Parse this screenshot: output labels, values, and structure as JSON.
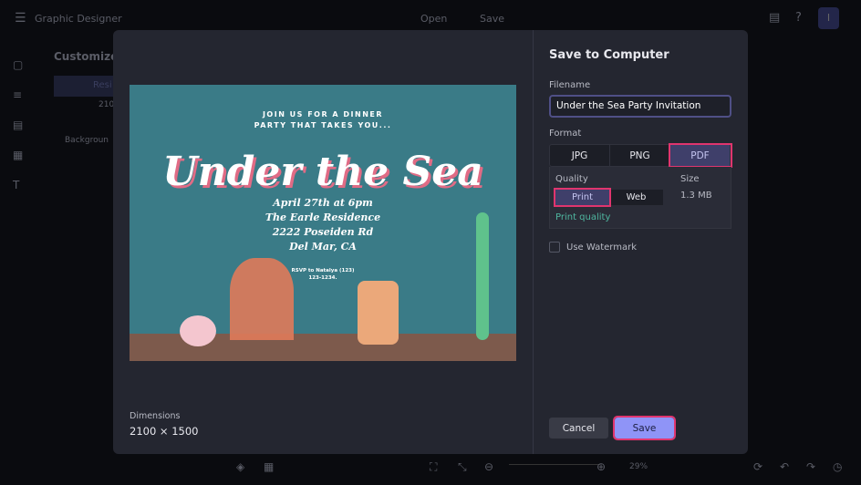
{
  "topbar": {
    "app_title": "Graphic Designer",
    "open_label": "Open",
    "save_label": "Save",
    "avatar_initial": "I"
  },
  "background_panel": {
    "title": "Customize",
    "resize_label": "Resi",
    "dims_partial": "210",
    "background_label": "Backgroun"
  },
  "preview": {
    "invitation": {
      "line1": "JOIN US FOR A DINNER",
      "line2": "PARTY THAT TAKES YOU...",
      "title": "Under the Sea",
      "date": "April 27th at 6pm",
      "place": "The Earle Residence",
      "address": "2222 Poseiden Rd",
      "city": "Del Mar, CA",
      "rsvp1": "RSVP to Natalya (123)",
      "rsvp2": "123-1234."
    },
    "dimensions_label": "Dimensions",
    "dimensions_value": "2100 × 1500"
  },
  "dialog": {
    "title": "Save to Computer",
    "filename_label": "Filename",
    "filename_value": "Under the Sea Party Invitation",
    "format_label": "Format",
    "formats": [
      "JPG",
      "PNG",
      "PDF"
    ],
    "selected_format": "PDF",
    "quality_label": "Quality",
    "qualities": [
      "Print",
      "Web"
    ],
    "selected_quality": "Print",
    "size_label": "Size",
    "size_value": "1.3 MB",
    "quality_note": "Print quality",
    "watermark_label": "Use Watermark",
    "watermark_checked": false,
    "cancel_label": "Cancel",
    "save_label": "Save"
  },
  "bottombar": {
    "zoom_value": "29%"
  },
  "colors": {
    "accent": "#8f94f7",
    "highlight": "#e0356e",
    "teal": "#4fb7a0"
  }
}
